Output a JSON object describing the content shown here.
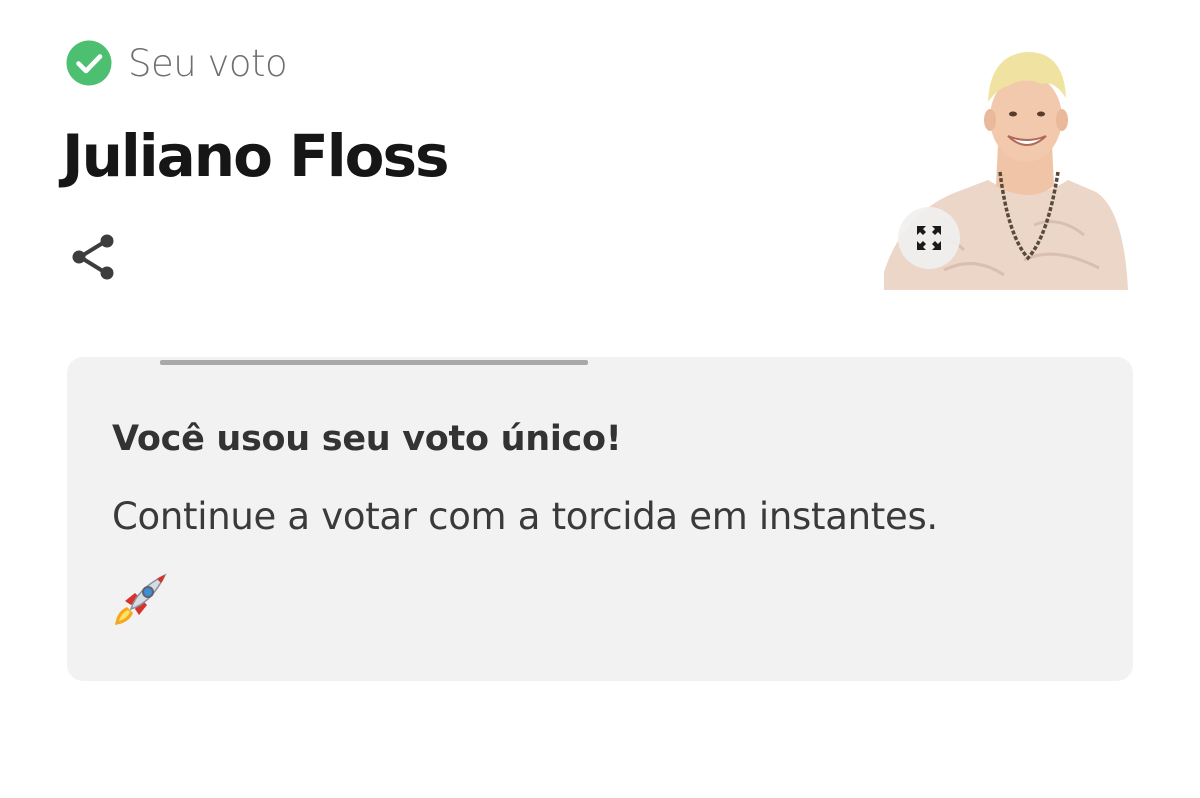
{
  "vote_header": {
    "status_label": "Seu voto",
    "status_icon": "check-circle-icon",
    "status_color": "#4cbf70"
  },
  "candidate": {
    "name": "Juliano Floss",
    "photo_icon": "candidate-photo"
  },
  "actions": {
    "share_icon": "share-icon",
    "expand_icon": "expand-icon"
  },
  "message": {
    "title": "Você usou seu voto único!",
    "body": "Continue a votar com a torcida em instantes.",
    "emoji_icon": "rocket-icon"
  },
  "colors": {
    "card_background": "#f2f2f2",
    "progress_track": "#a9a9a9",
    "text_primary": "#161616"
  }
}
